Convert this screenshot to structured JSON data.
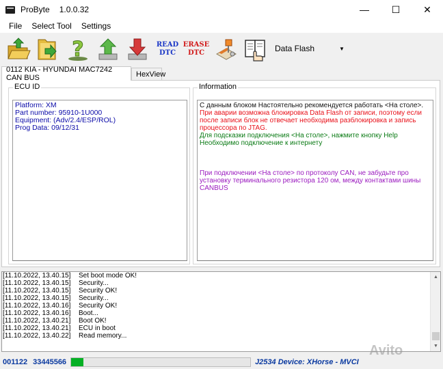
{
  "window": {
    "app_name": "ProByte",
    "version": "1.0.0.32"
  },
  "menu": [
    "File",
    "Select Tool",
    "Settings"
  ],
  "toolbar": {
    "buttons": [
      {
        "name": "open-folder-icon"
      },
      {
        "name": "folder-arrow-icon"
      },
      {
        "name": "help-question-icon"
      },
      {
        "name": "upload-arrow-icon"
      },
      {
        "name": "download-arrow-icon"
      },
      {
        "name": "read-dtc-button",
        "line1": "READ",
        "line2": "DTC"
      },
      {
        "name": "erase-dtc-button",
        "line1": "ERASE",
        "line2": "DTC"
      },
      {
        "name": "tools-icon"
      },
      {
        "name": "manual-hand-icon"
      }
    ],
    "memory_select": "Data Flash"
  },
  "tabs": [
    "0112 KIA - HYUNDAI MAC7242 CAN BUS",
    "HexView"
  ],
  "ecu": {
    "title": "ECU ID",
    "lines": [
      "Platform: XM",
      "Part number: 95910-1U000",
      "Equipment: (Adv/2.4/ESP/ROL)",
      "Prog Data: 09/12/31"
    ]
  },
  "info": {
    "title": "Information",
    "black": "С данным блоком Настоятельно рекомендуется работать <На столе>.",
    "red": "При аварии возможна блокировка Data Flash от записи, поэтому если после записи блок не отвечает необходима разблокировка и запись процессора по JTAG.",
    "green": "Для подсказки подключения <На столе>, нажмите кнопку Help Необходимо подключение к интернету",
    "purple": "При подключении  <На столе> по протоколу CAN, не забудьте про установку терминального резистора 120 ом, между контактами шины CANBUS"
  },
  "log": [
    {
      "time": "[11.10.2022, 13.40.15]",
      "msg": "Set boot mode OK!"
    },
    {
      "time": "[11.10.2022, 13.40.15]",
      "msg": "Security..."
    },
    {
      "time": "[11.10.2022, 13.40.15]",
      "msg": "Security OK!"
    },
    {
      "time": "[11.10.2022, 13.40.15]",
      "msg": "Security..."
    },
    {
      "time": "[11.10.2022, 13.40.16]",
      "msg": "Security OK!"
    },
    {
      "time": "[11.10.2022, 13.40.16]",
      "msg": "Boot..."
    },
    {
      "time": "[11.10.2022, 13.40.21]",
      "msg": "Boot OK!"
    },
    {
      "time": "[11.10.2022, 13.40.21]",
      "msg": "ECU in boot"
    },
    {
      "time": "[11.10.2022, 13.40.22]",
      "msg": "Read memory..."
    }
  ],
  "status": {
    "code": "001122",
    "number": "33445566",
    "progress": 0.07,
    "device": "J2534 Device: XHorse - MVCI"
  },
  "watermark": "Avito",
  "colors": {
    "progress": "#06b025",
    "status_text": "#0b3aa0",
    "ecu_text": "#0a0aa8",
    "info_red": "#e8111a",
    "info_green": "#0a7a14",
    "info_purple": "#9b1bbf"
  }
}
